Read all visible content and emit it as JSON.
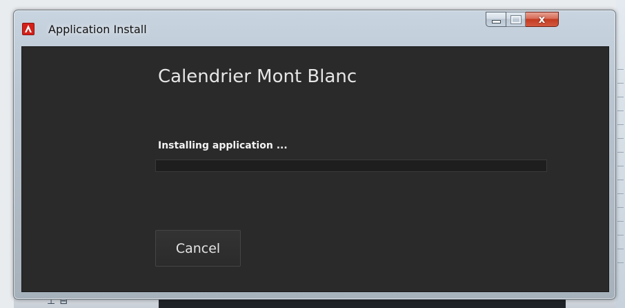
{
  "window": {
    "title": "Application Install",
    "icon": "adobe-air-icon"
  },
  "caption_buttons": {
    "minimize_icon": "minimize-icon",
    "maximize_icon": "maximize-icon",
    "close_icon": "close-icon",
    "close_glyph": "x"
  },
  "main": {
    "app_name": "Calendrier Mont Blanc",
    "status": "Installing application ...",
    "progress": 0,
    "cancel_label": "Cancel"
  },
  "colors": {
    "client_background": "#2a2a2a",
    "close_button": "#c23b21",
    "app_icon": "#d4201a"
  }
}
